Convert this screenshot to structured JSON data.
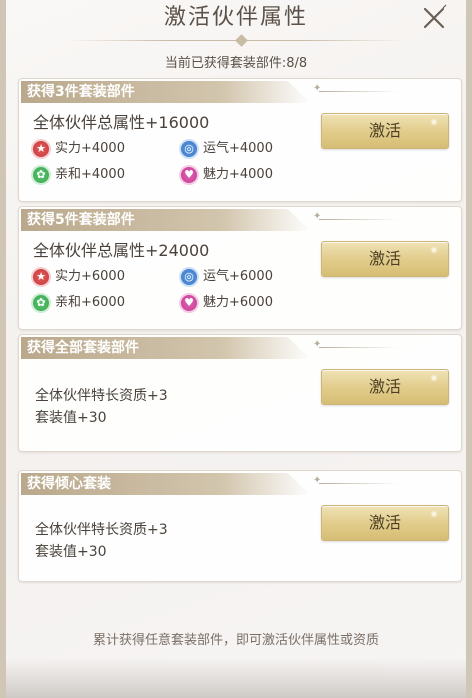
{
  "window": {
    "title": "激活伙伴属性",
    "close_icon": "close-icon"
  },
  "progress_text": "当前已获得套装部件:8/8",
  "footer_text": "累计获得任意套装部件，即可激活伙伴属性或资质",
  "colors": {
    "header_gold": "#b9a88b",
    "button_gold": "#e2cd8c",
    "strength": "#c9393c",
    "luck": "#3e76c6",
    "affinity": "#38a652",
    "charm": "#c53f96"
  },
  "cards": [
    {
      "header": "获得3件套装部件",
      "total": "全体伙伴总属性+16000",
      "stats": {
        "strength": "实力+4000",
        "luck": "运气+4000",
        "affinity": "亲和+4000",
        "charm": "魅力+4000"
      },
      "button": "激活"
    },
    {
      "header": "获得5件套装部件",
      "total": "全体伙伴总属性+24000",
      "stats": {
        "strength": "实力+6000",
        "luck": "运气+6000",
        "affinity": "亲和+6000",
        "charm": "魅力+6000"
      },
      "button": "激活"
    },
    {
      "header": "获得全部套装部件",
      "line1": "全体伙伴特长资质+3",
      "line2": "套装值+30",
      "button": "激活"
    },
    {
      "header": "获得倾心套装",
      "line1": "全体伙伴特长资质+3",
      "line2": "套装值+30",
      "button": "激活"
    }
  ]
}
